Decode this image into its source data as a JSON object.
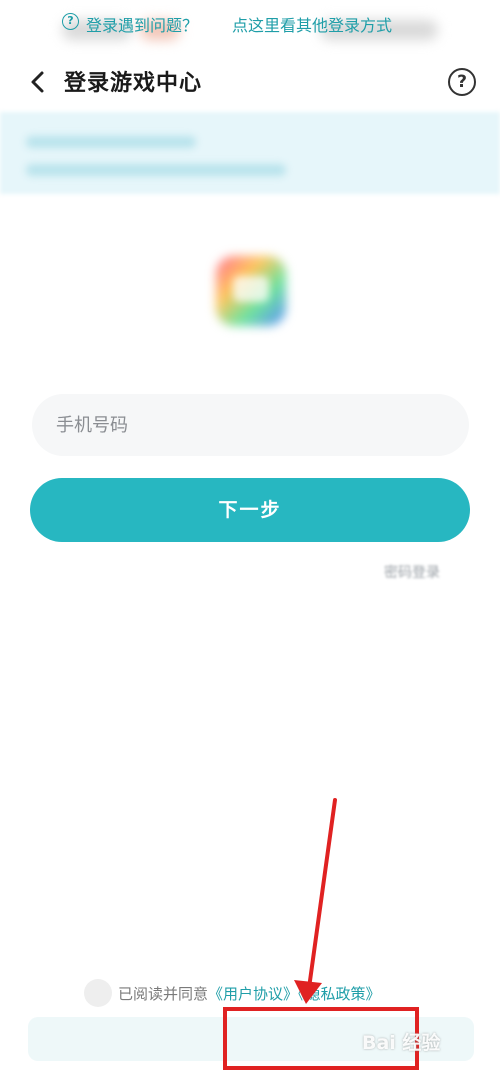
{
  "header": {
    "title": "登录游戏中心",
    "help_label": "?"
  },
  "form": {
    "phone_placeholder": "手机号码",
    "next_label": "下一步",
    "password_login_label": "密码登录"
  },
  "agreement": {
    "prefix": "已阅读并同意",
    "user_agreement": "《用户协议》",
    "privacy_policy": "《隐私政策》"
  },
  "help_bar": {
    "question_icon": "?",
    "problem_text": "登录遇到问题？",
    "other_methods_link": "点这里看其他登录方式"
  },
  "watermark": "Bai 经验",
  "colors": {
    "accent": "#27b7c1",
    "link": "#1f9ea8",
    "annotation": "#e02222"
  }
}
